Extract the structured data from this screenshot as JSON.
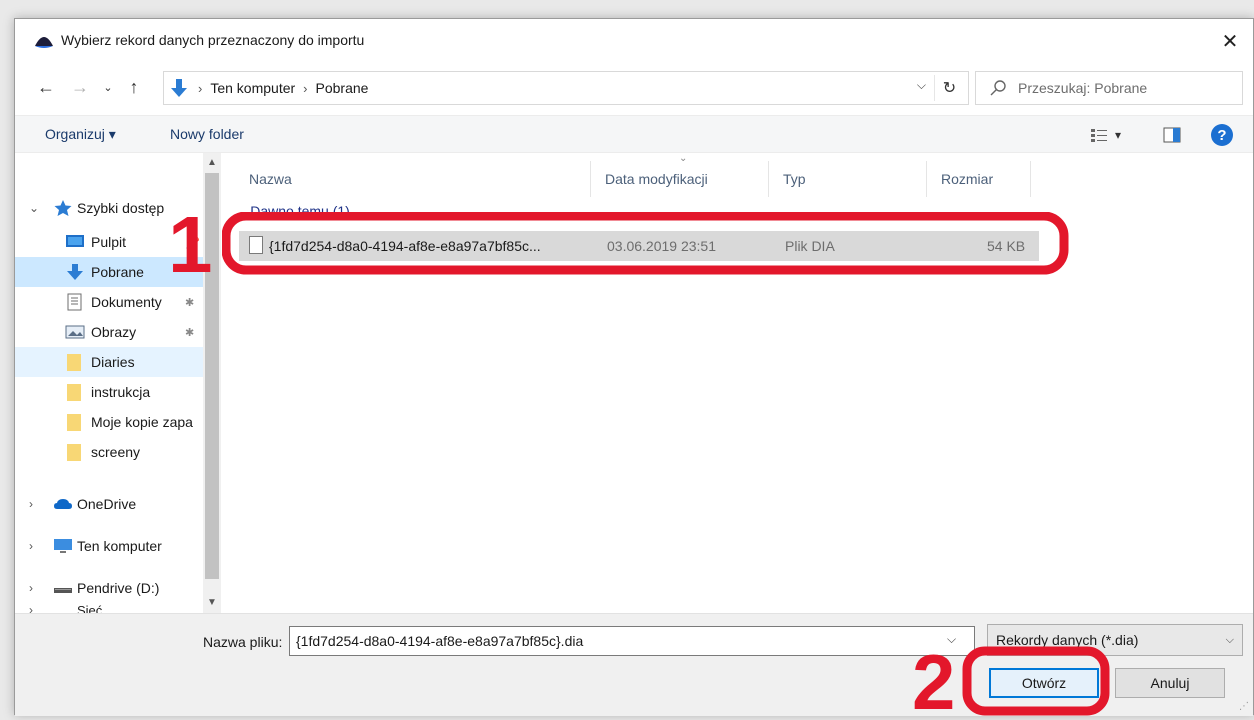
{
  "window": {
    "title": "Wybierz rekord danych przeznaczony do importu",
    "close": "✕"
  },
  "address": {
    "segments": [
      "Ten komputer",
      "Pobrane"
    ],
    "separator": "›",
    "dropdown": "⌵",
    "refresh": "↻"
  },
  "search": {
    "placeholder": "Przeszukaj: Pobrane"
  },
  "toolbar": {
    "organize": "Organizuj ▾",
    "new_folder": "Nowy folder",
    "view_menu": "▾",
    "help": "?"
  },
  "nav": {
    "quick_access": "Szybki dostęp",
    "items": [
      {
        "label": "Pulpit",
        "icon": "desktop-icon",
        "pinned": true
      },
      {
        "label": "Pobrane",
        "icon": "download-icon",
        "pinned": true
      },
      {
        "label": "Dokumenty",
        "icon": "documents-icon",
        "pinned": true
      },
      {
        "label": "Obrazy",
        "icon": "pictures-icon",
        "pinned": true
      },
      {
        "label": "Diaries",
        "icon": "folder-icon"
      },
      {
        "label": "instrukcja",
        "icon": "folder-icon"
      },
      {
        "label": "Moje kopie zapa",
        "icon": "folder-icon"
      },
      {
        "label": "screeny",
        "icon": "folder-icon"
      }
    ],
    "onedrive": "OneDrive",
    "this_pc": "Ten komputer",
    "pendrive": "Pendrive (D:)",
    "network": "Sieć"
  },
  "columns": [
    "Nazwa",
    "Data modyfikacji",
    "Typ",
    "Rozmiar"
  ],
  "group": {
    "label": "Dawno temu (1)"
  },
  "files": [
    {
      "name": "{1fd7d254-d8a0-4194-af8e-e8a97a7bf85c...",
      "date": "03.06.2019 23:51",
      "type": "Plik DIA",
      "size": "54 KB"
    }
  ],
  "bottom": {
    "filename_label": "Nazwa pliku:",
    "filename_value": "{1fd7d254-d8a0-4194-af8e-e8a97a7bf85c}.dia",
    "filetype": "Rekordy danych (*.dia)",
    "open": "Otwórz",
    "cancel": "Anuluj"
  },
  "annotations": {
    "step1": "1",
    "step2": "2",
    "color": "#e3172b"
  },
  "colors": {
    "selection": "#cce8ff",
    "accent": "#0078d7",
    "annotation": "#e3172b"
  }
}
